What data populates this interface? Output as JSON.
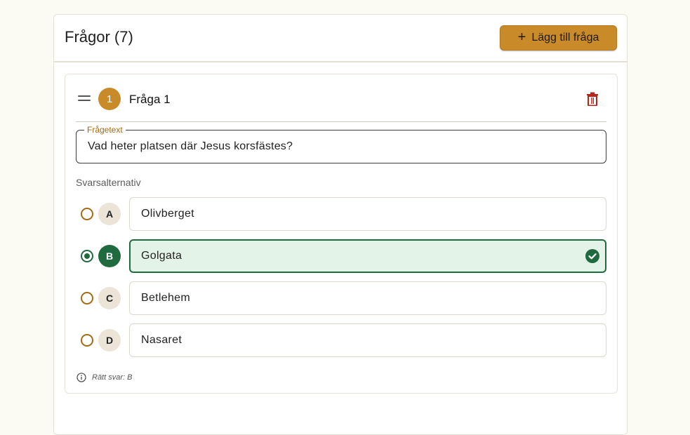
{
  "header": {
    "title": "Frågor (7)",
    "add_button_icon": "+",
    "add_button_label": "Lägg till fråga"
  },
  "question": {
    "number": "1",
    "title": "Fråga 1",
    "text_field_label": "Frågetext",
    "text_field_value": "Vad heter platsen där Jesus korsfästes?",
    "options_label": "Svarsalternativ",
    "options": [
      {
        "letter": "A",
        "text": "Olivberget",
        "correct": false
      },
      {
        "letter": "B",
        "text": "Golgata",
        "correct": true
      },
      {
        "letter": "C",
        "text": "Betlehem",
        "correct": false
      },
      {
        "letter": "D",
        "text": "Nasaret",
        "correct": false
      }
    ],
    "correct_answer_text": "Rätt svar: B"
  },
  "colors": {
    "accent": "#c98a2a",
    "correct": "#1f6b3f",
    "correct_bg": "#e3f3e8",
    "danger": "#b3261e"
  },
  "icons": {
    "drag": "drag-handle-icon",
    "delete": "trash-icon",
    "correct": "check-circle-icon",
    "info": "info-icon"
  }
}
